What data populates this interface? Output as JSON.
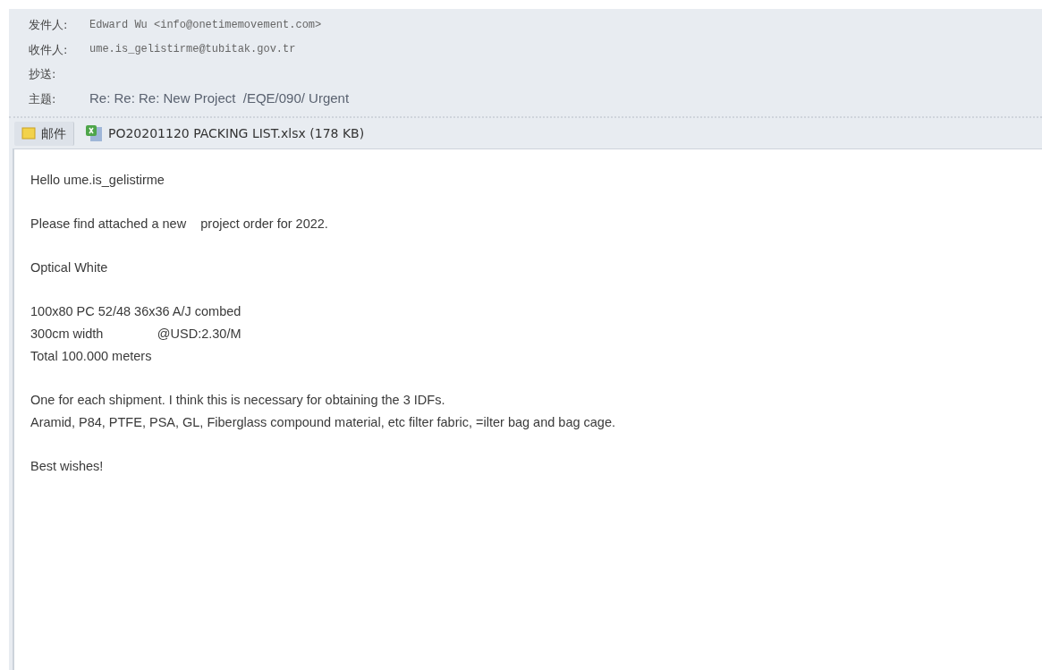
{
  "header_fields": [
    {
      "label": "发件人:",
      "value": "Edward Wu <info@onetimemovement.com>"
    },
    {
      "label": "收件人:",
      "value": "ume.is_gelistirme@tubitak.gov.tr"
    },
    {
      "label": "抄送:"
    },
    {
      "label": "主题:",
      "value": "Re: Re: Re: New Project  /EQE/090/ Urgent",
      "kind": "subject"
    }
  ],
  "tabs": [
    {
      "label": "邮件",
      "kind": "message",
      "selected": true
    },
    {
      "label": "PO20201120 PACKING LIST.xlsx (178 KB)",
      "kind": "excel",
      "selected": false
    }
  ],
  "body_paragraphs": [
    [
      "Hello ume.is_gelistirme"
    ],
    [
      "Please find attached a new    project order for 2022."
    ],
    [
      "Optical White"
    ],
    [
      "100x80 PC 52/48 36x36 A/J combed",
      "300cm width               @USD:2.30/M",
      "Total 100.000 meters"
    ],
    [
      "One for each shipment. I think this is necessary for obtaining the 3 IDFs.",
      "Aramid, P84, PTFE, PSA, GL, Fiberglass compound material, etc filter fabric, =ilter bag and bag cage."
    ],
    [
      "Best wishes!"
    ]
  ]
}
